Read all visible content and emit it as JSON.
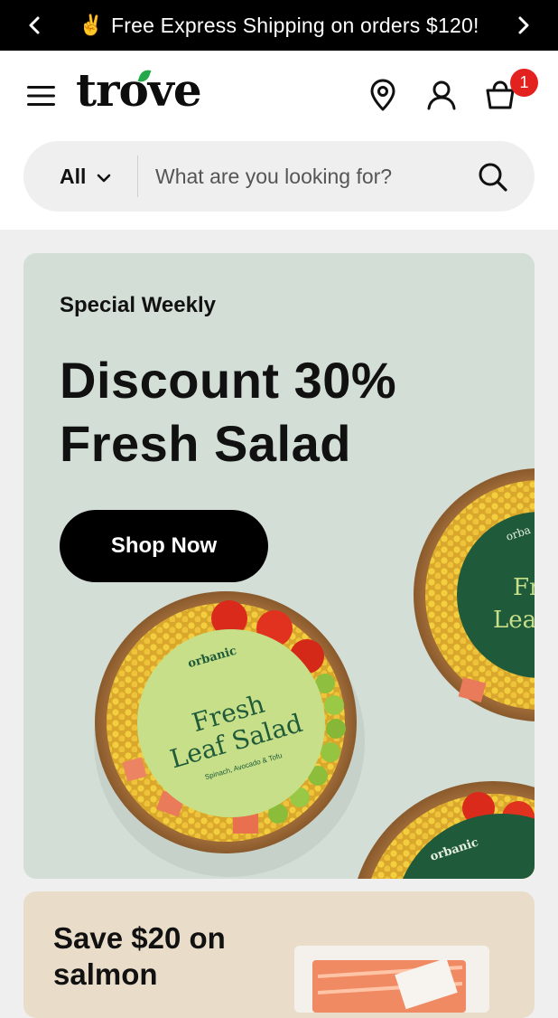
{
  "announcement": {
    "emoji": "✌️",
    "text": "Free Express Shipping on orders $120!"
  },
  "header": {
    "logo": "trove",
    "cart_count": "1",
    "icons": [
      "menu-icon",
      "location-pin-icon",
      "account-icon",
      "shopping-bag-icon"
    ]
  },
  "search": {
    "category": "All",
    "placeholder": "What are you looking for?"
  },
  "hero": {
    "eyebrow": "Special Weekly",
    "headline_line1": "Discount 30%",
    "headline_line2": "Fresh Salad",
    "cta_label": "Shop Now",
    "product_brand": "orbanic",
    "product_name_line1": "Fresh",
    "product_name_line2": "Leaf Salad",
    "product_sub": "Spinach, Avocado & Tofu",
    "brand_color": "#1f5a3a",
    "label_color": "#c7df88"
  },
  "promo": {
    "title": "Save $20 on salmon"
  },
  "colors": {
    "badge": "#e3211f",
    "hero_bg": "#d3ded7",
    "promo_bg": "#e9ddca",
    "logo_accent": "#23a94a"
  }
}
